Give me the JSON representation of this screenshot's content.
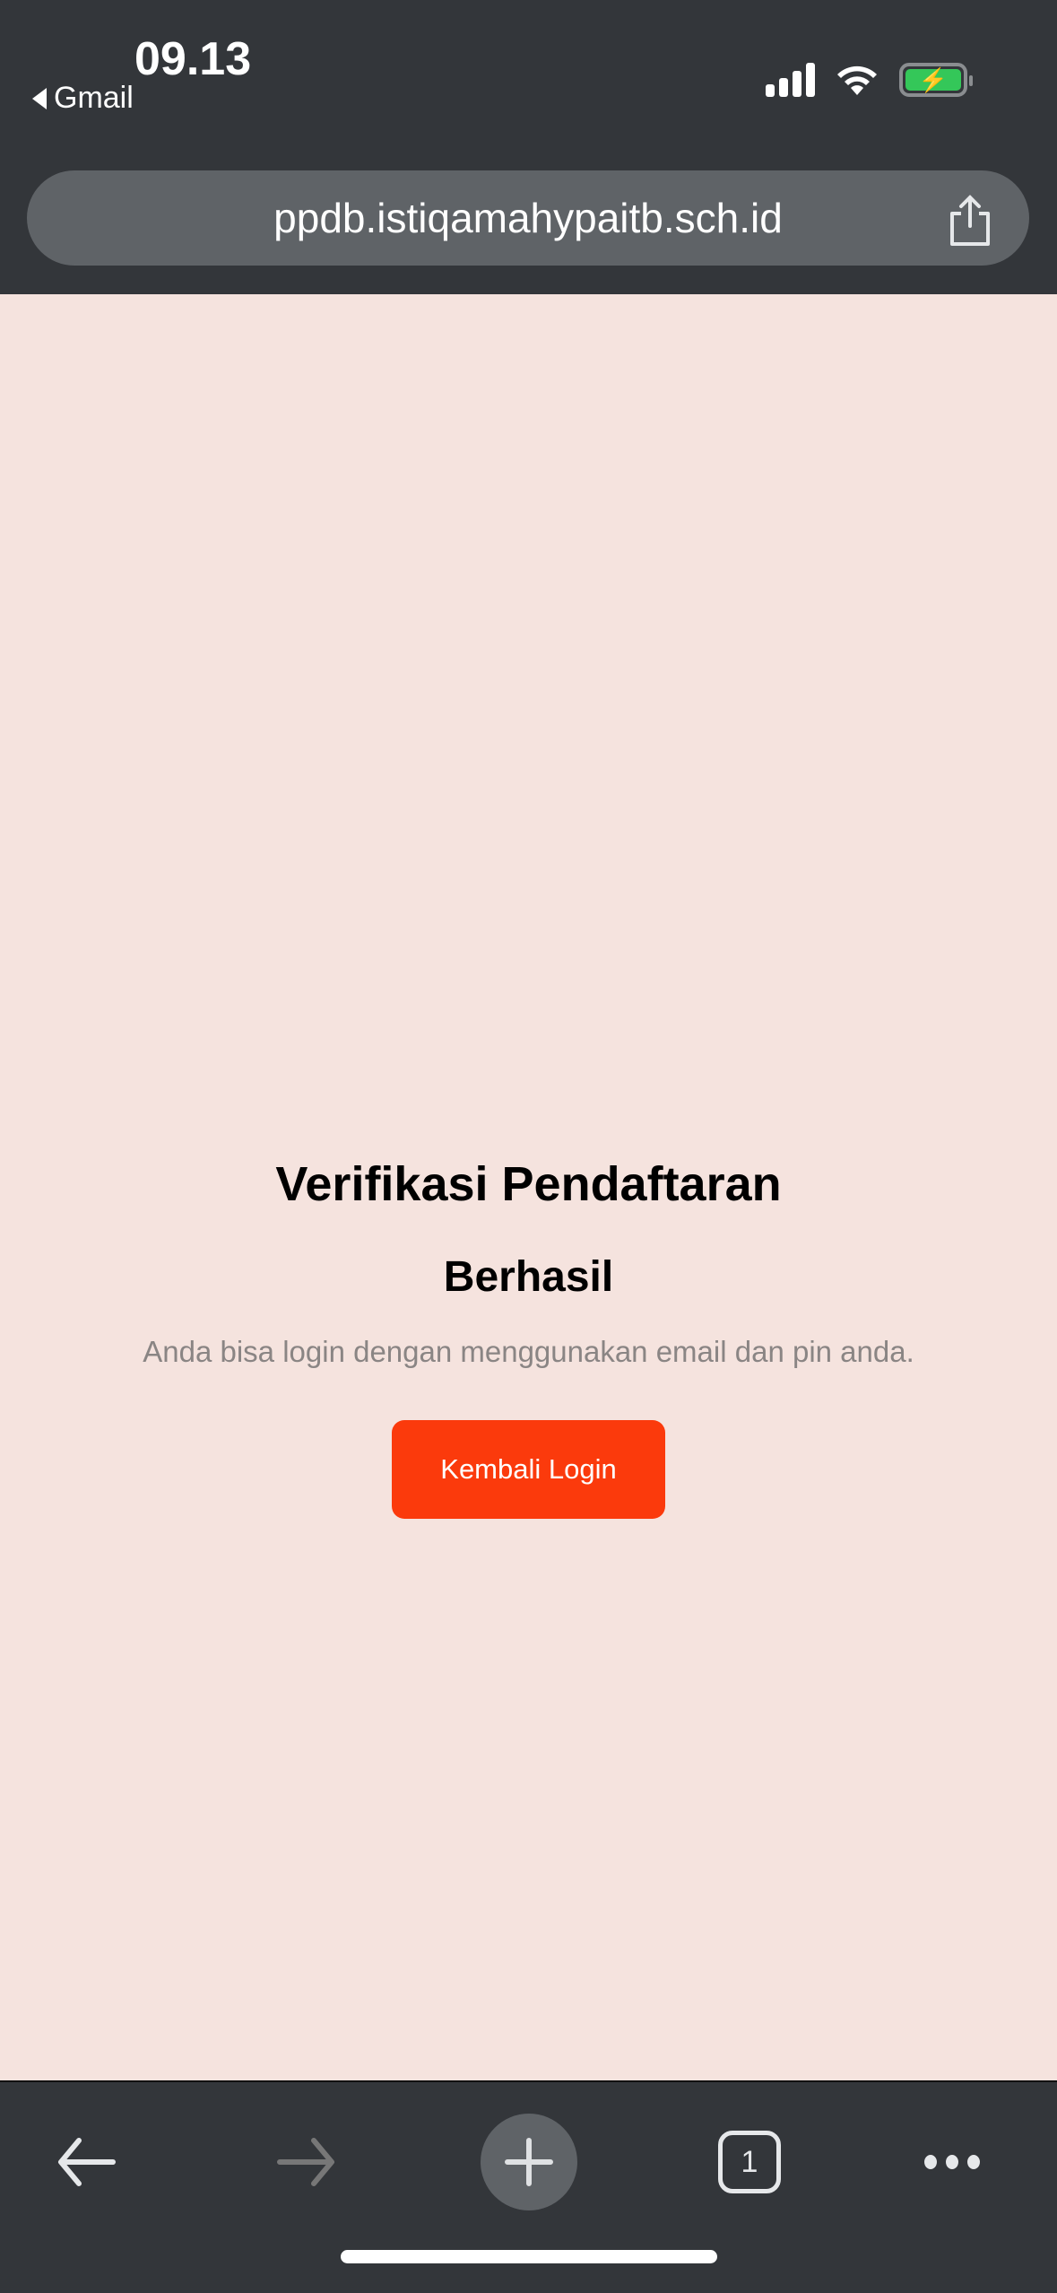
{
  "status_bar": {
    "time": "09.13",
    "back_app": "Gmail"
  },
  "browser": {
    "url": "ppdb.istiqamahypaitb.sch.id",
    "tab_count": "1"
  },
  "page": {
    "title": "Verifikasi Pendaftaran",
    "status": "Berhasil",
    "message": "Anda bisa login dengan menggunakan email dan pin anda.",
    "button_label": "Kembali Login"
  },
  "colors": {
    "page_bg": "#f5e3de",
    "button": "#fb3a0c",
    "chrome": "#33363a"
  }
}
